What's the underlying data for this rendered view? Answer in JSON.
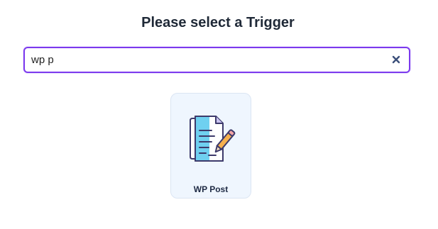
{
  "header": {
    "title": "Please select a Trigger"
  },
  "search": {
    "value": "wp p",
    "clear_icon": "close-icon"
  },
  "results": [
    {
      "label": "WP Post",
      "icon": "document-edit-icon"
    }
  ],
  "colors": {
    "accent": "#7c3aed",
    "card_background": "#eff6fe",
    "card_border": "#dbe5f3",
    "clear_icon": "#3b4f7a",
    "icon_blue": "#6fd0f0"
  }
}
